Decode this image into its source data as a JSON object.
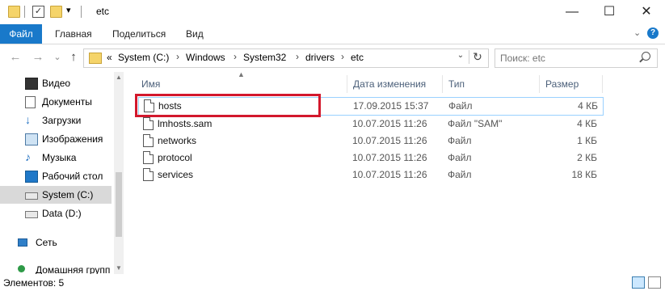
{
  "window": {
    "title": "etc",
    "qat_dropdown": "▾",
    "controls": {
      "minimize": "—",
      "maximize": "☐",
      "close": "✕"
    }
  },
  "ribbon": {
    "file_tab": "Файл",
    "tabs": [
      "Главная",
      "Поделиться",
      "Вид"
    ],
    "collapse_glyph": "⌄",
    "help_glyph": "?",
    "file_tab_color": "#1979ca"
  },
  "address": {
    "overflow": "«",
    "crumbs": [
      "System (C:)",
      "Windows",
      "System32",
      "drivers",
      "etc"
    ],
    "dropdown_glyph": "⌄",
    "refresh_glyph": "↻"
  },
  "nav": {
    "back": "←",
    "forward": "→",
    "recent": "⌄",
    "up": "↑"
  },
  "search": {
    "placeholder": "Поиск: etc"
  },
  "sidebar": {
    "items": [
      {
        "label": "Видео",
        "icon": "video-icon"
      },
      {
        "label": "Документы",
        "icon": "documents-icon"
      },
      {
        "label": "Загрузки",
        "icon": "downloads-icon"
      },
      {
        "label": "Изображения",
        "icon": "pictures-icon"
      },
      {
        "label": "Музыка",
        "icon": "music-icon"
      },
      {
        "label": "Рабочий стол",
        "icon": "desktop-icon"
      },
      {
        "label": "System (C:)",
        "icon": "drive-c-icon",
        "selected": true
      },
      {
        "label": "Data (D:)",
        "icon": "drive-d-icon"
      },
      {
        "label": "Сеть",
        "icon": "network-icon"
      },
      {
        "label": "Домашняя групп",
        "icon": "homegroup-icon"
      }
    ]
  },
  "columns": [
    "Имя",
    "Дата изменения",
    "Тип",
    "Размер"
  ],
  "sort_glyph": "▲",
  "files": [
    {
      "name": "hosts",
      "modified": "17.09.2015 15:37",
      "type": "Файл",
      "size": "4 КБ"
    },
    {
      "name": "lmhosts.sam",
      "modified": "10.07.2015 11:26",
      "type": "Файл \"SAM\"",
      "size": "4 КБ"
    },
    {
      "name": "networks",
      "modified": "10.07.2015 11:26",
      "type": "Файл",
      "size": "1 КБ"
    },
    {
      "name": "protocol",
      "modified": "10.07.2015 11:26",
      "type": "Файл",
      "size": "2 КБ"
    },
    {
      "name": "services",
      "modified": "10.07.2015 11:26",
      "type": "Файл",
      "size": "18 КБ"
    }
  ],
  "highlight_color": "#d3182c",
  "status": {
    "item_count": "Элементов: 5"
  }
}
